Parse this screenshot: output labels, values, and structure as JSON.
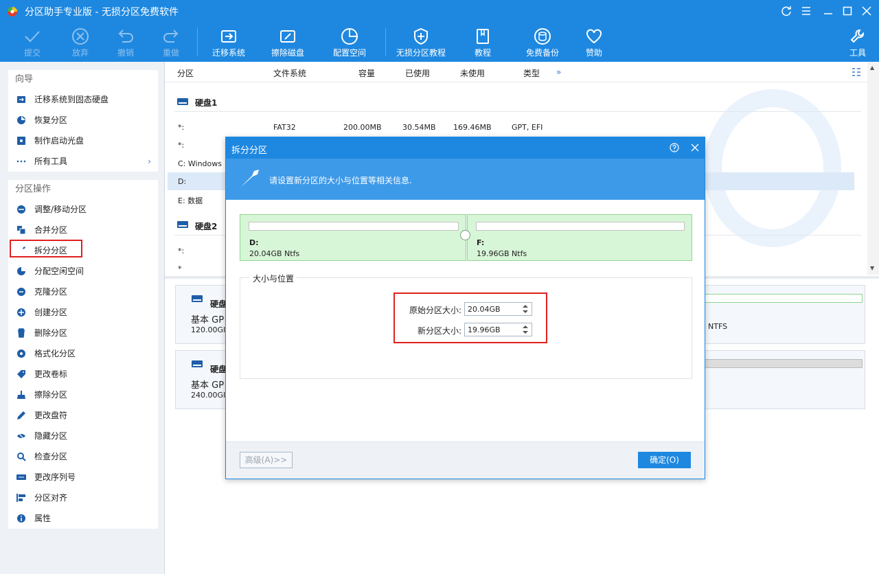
{
  "window": {
    "title": "分区助手专业版 - 无损分区免费软件"
  },
  "toolbar": {
    "items": [
      {
        "label": "提交",
        "icon": "check-icon",
        "disabled": true
      },
      {
        "label": "放弃",
        "icon": "cancel-circle-icon",
        "disabled": true
      },
      {
        "label": "撤销",
        "icon": "undo-icon",
        "disabled": true
      },
      {
        "label": "重做",
        "icon": "redo-icon",
        "disabled": true
      },
      {
        "label": "迁移系统",
        "icon": "migrate-os-icon"
      },
      {
        "label": "擦除磁盘",
        "icon": "wipe-disk-icon"
      },
      {
        "label": "配置空间",
        "icon": "allocate-space-icon"
      },
      {
        "label": "无损分区教程",
        "icon": "shield-plus-icon"
      },
      {
        "label": "教程",
        "icon": "book-icon"
      },
      {
        "label": "免费备份",
        "icon": "backup-icon"
      },
      {
        "label": "赞助",
        "icon": "heart-icon"
      },
      {
        "label": "工具",
        "icon": "tools-icon"
      }
    ]
  },
  "sidebar": {
    "wizard": {
      "title": "向导",
      "items": [
        {
          "label": "迁移系统到固态硬盘",
          "icon": "ssd-migrate-icon"
        },
        {
          "label": "恢复分区",
          "icon": "recover-icon"
        },
        {
          "label": "制作启动光盘",
          "icon": "bootable-cd-icon"
        },
        {
          "label": "所有工具",
          "icon": "more-dots-icon"
        }
      ]
    },
    "ops": {
      "title": "分区操作",
      "items": [
        {
          "label": "调整/移动分区",
          "icon": "resize-icon"
        },
        {
          "label": "合并分区",
          "icon": "merge-icon"
        },
        {
          "label": "拆分分区",
          "icon": "split-icon"
        },
        {
          "label": "分配空闲空间",
          "icon": "allocate-free-icon"
        },
        {
          "label": "克隆分区",
          "icon": "clone-icon"
        },
        {
          "label": "创建分区",
          "icon": "create-icon"
        },
        {
          "label": "删除分区",
          "icon": "trash-icon"
        },
        {
          "label": "格式化分区",
          "icon": "format-icon"
        },
        {
          "label": "更改卷标",
          "icon": "tag-icon"
        },
        {
          "label": "擦除分区",
          "icon": "wipe-icon"
        },
        {
          "label": "更改盘符",
          "icon": "pen-icon"
        },
        {
          "label": "隐藏分区",
          "icon": "hide-icon"
        },
        {
          "label": "检查分区",
          "icon": "check-partition-icon"
        },
        {
          "label": "更改序列号",
          "icon": "serial-icon"
        },
        {
          "label": "分区对齐",
          "icon": "align-icon"
        },
        {
          "label": "属性",
          "icon": "info-icon"
        }
      ]
    }
  },
  "table": {
    "columns": [
      "分区",
      "文件系统",
      "容量",
      "已使用",
      "未使用",
      "类型",
      "»"
    ],
    "disk1": {
      "label": "硬盘1",
      "rows": [
        {
          "name": "*:",
          "fs": "FAT32",
          "capacity": "200.00MB",
          "used": "30.54MB",
          "free": "169.46MB",
          "type": "GPT, EFI"
        },
        {
          "name": "*:"
        },
        {
          "name": "C: Windows"
        },
        {
          "name": "D:"
        },
        {
          "name": "E: 数据"
        }
      ]
    },
    "disk2": {
      "label": "硬盘2",
      "rows": [
        {
          "name": "*:"
        },
        {
          "name": "*"
        }
      ]
    }
  },
  "cards": [
    {
      "name": "硬盘",
      "type": "基本 GP",
      "size": "120.00GI",
      "right_label": "NTFS"
    },
    {
      "name": "硬盘",
      "type": "基本 GP",
      "size": "240.00GI"
    }
  ],
  "dialog": {
    "title": "拆分分区",
    "banner": "请设置新分区的大小与位置等相关信息.",
    "left_part": {
      "name": "D:",
      "size": "20.04GB Ntfs"
    },
    "right_part": {
      "name": "F:",
      "size": "19.96GB Ntfs"
    },
    "group_title": "大小与位置",
    "orig_label": "原始分区大小:",
    "orig_value": "20.04GB",
    "new_label": "新分区大小:",
    "new_value": "19.96GB",
    "advanced": "高级(A)>>",
    "ok": "确定(O)"
  },
  "colors": {
    "accent": "#1e88e0",
    "partition_fill": "#d7f5d7",
    "highlight": "#e02020"
  }
}
